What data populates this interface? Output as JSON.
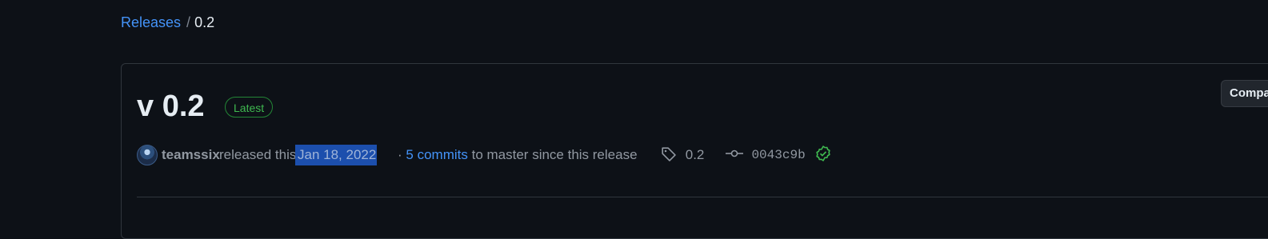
{
  "breadcrumb": {
    "root_label": "Releases",
    "separator": "/",
    "current_label": "0.2"
  },
  "release": {
    "title": "v 0.2",
    "badge": "Latest",
    "compare_label": "Compare",
    "author": "teamssix",
    "released_text": "released this",
    "date": "Jan 18, 2022",
    "commits_prefix": "·",
    "commits_link": "5 commits",
    "commits_suffix": "to master since this release",
    "tag": "0.2",
    "commit_sha": "0043c9b"
  },
  "colors": {
    "background": "#0d1117",
    "link": "#4493f8",
    "badge_green": "#3fb950",
    "selection": "#1c4fad",
    "muted_text": "#9198a1"
  },
  "icons": {
    "tag": "tag-icon",
    "commit": "git-commit-icon",
    "verified": "verified-check-icon",
    "avatar": "user-avatar"
  }
}
